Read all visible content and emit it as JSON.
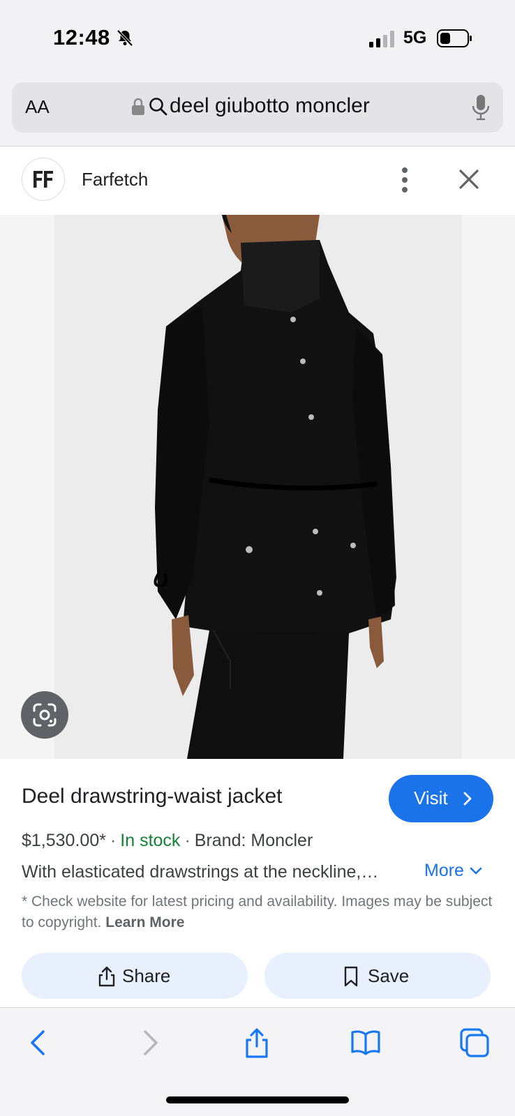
{
  "status_bar": {
    "time": "12:48",
    "network": "5G"
  },
  "url_bar": {
    "text_size_label": "AA",
    "query": "deel giubotto moncler"
  },
  "source": {
    "name": "Farfetch"
  },
  "product": {
    "title": "Deel drawstring-waist jacket",
    "visit_label": "Visit",
    "price": "$1,530.00*",
    "stock": "In stock",
    "brand": "Brand: Moncler",
    "separator": "·",
    "description": "With elasticated drawstrings at the neckline,…",
    "more_label": "More",
    "disclaimer": "* Check website for latest pricing and availability. Images may be subject to copyright.",
    "learn_more": "Learn More"
  },
  "actions": {
    "share_label": "Share",
    "save_label": "Save"
  },
  "colors": {
    "accent": "#1a73e8",
    "in_stock": "#188038",
    "pill_bg": "#e8f0fe",
    "ios_blue": "#1877f2"
  },
  "icons": {
    "status": [
      "bell-slash-icon",
      "signal-icon",
      "battery-icon"
    ],
    "url_bar": [
      "lock-icon",
      "search-icon",
      "microphone-icon"
    ],
    "toolbar": [
      "back-icon",
      "forward-icon",
      "share-icon",
      "bookmarks-icon",
      "tabs-icon"
    ]
  }
}
